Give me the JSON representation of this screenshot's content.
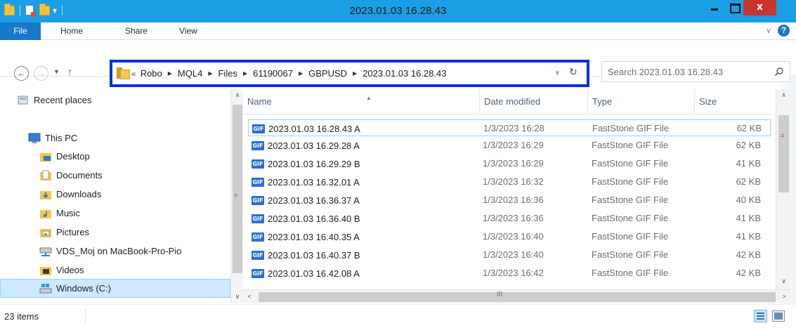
{
  "window": {
    "title": "2023.01.03 16.28.43",
    "close_glyph": "x"
  },
  "ribbon": {
    "tabs": [
      {
        "label": "File"
      },
      {
        "label": "Home"
      },
      {
        "label": "Share"
      },
      {
        "label": "View"
      }
    ],
    "help_glyph": "?"
  },
  "navigation": {
    "back": "←",
    "forward": "→",
    "up": "↑"
  },
  "address_bar": {
    "overflow": "«",
    "crumbs": [
      "Robo",
      "MQL4",
      "Files",
      "61190067",
      "GBPUSD",
      "2023.01.03 16.28.43"
    ],
    "highlight_color": "#0a32d4"
  },
  "search": {
    "placeholder": "Search 2023.01.03 16.28.43"
  },
  "nav_pane": {
    "items": [
      {
        "label": "Recent places",
        "icon": "recent-places-icon"
      },
      {
        "label": "This PC",
        "icon": "pc-icon"
      },
      {
        "label": "Desktop",
        "icon": "desktop-folder-icon"
      },
      {
        "label": "Documents",
        "icon": "documents-folder-icon"
      },
      {
        "label": "Downloads",
        "icon": "downloads-folder-icon"
      },
      {
        "label": "Music",
        "icon": "music-folder-icon"
      },
      {
        "label": "Pictures",
        "icon": "pictures-folder-icon"
      },
      {
        "label": "VDS_Moj on MacBook-Pro-Pio",
        "icon": "network-drive-icon"
      },
      {
        "label": "Videos",
        "icon": "videos-folder-icon"
      },
      {
        "label": "Windows (C:)",
        "icon": "drive-icon"
      }
    ]
  },
  "file_list": {
    "columns": [
      "Name",
      "Date modified",
      "Type",
      "Size"
    ],
    "rows": [
      {
        "name": "2023.01.03 16.28.43 A",
        "date": "1/3/2023 16:28",
        "type": "FastStone GIF File",
        "size": "62 KB"
      },
      {
        "name": "2023.01.03 16.29.28 A",
        "date": "1/3/2023 16:29",
        "type": "FastStone GIF File",
        "size": "62 KB"
      },
      {
        "name": "2023.01.03 16.29.29 B",
        "date": "1/3/2023 16:29",
        "type": "FastStone GIF File",
        "size": "41 KB"
      },
      {
        "name": "2023.01.03 16.32.01 A",
        "date": "1/3/2023 16:32",
        "type": "FastStone GIF File",
        "size": "62 KB"
      },
      {
        "name": "2023.01.03 16.36.37 A",
        "date": "1/3/2023 16:36",
        "type": "FastStone GIF File",
        "size": "40 KB"
      },
      {
        "name": "2023.01.03 16.36.40 B",
        "date": "1/3/2023 16:36",
        "type": "FastStone GIF File",
        "size": "41 KB"
      },
      {
        "name": "2023.01.03 16.40.35 A",
        "date": "1/3/2023 16:40",
        "type": "FastStone GIF File",
        "size": "41 KB"
      },
      {
        "name": "2023.01.03 16.40.37 B",
        "date": "1/3/2023 16:40",
        "type": "FastStone GIF File",
        "size": "42 KB"
      },
      {
        "name": "2023.01.03 16.42.08 A",
        "date": "1/3/2023 16:42",
        "type": "FastStone GIF File",
        "size": "42 KB"
      }
    ]
  },
  "status_bar": {
    "item_count": "23 items"
  },
  "colors": {
    "titlebar": "#1a9ee6",
    "file_tab": "#1979ca",
    "close_button": "#c9352b",
    "selection": "#cde8ff"
  }
}
